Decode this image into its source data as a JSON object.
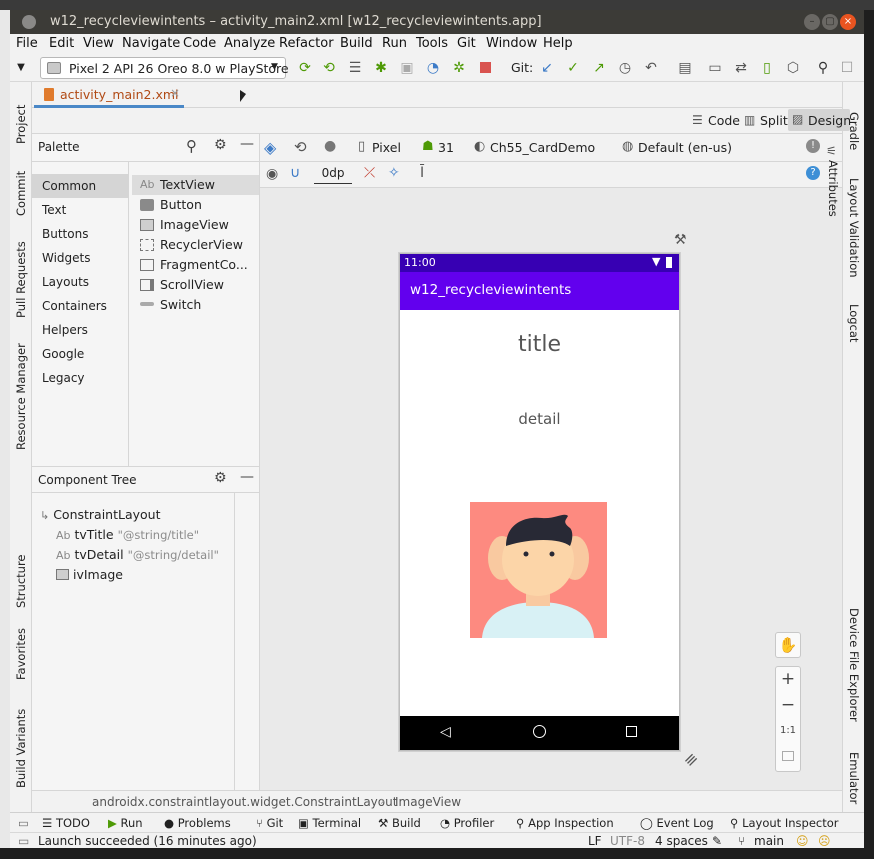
{
  "window": {
    "title": "w12_recycleviewintents – activity_main2.xml [w12_recycleviewintents.app]"
  },
  "menu": [
    "File",
    "Edit",
    "View",
    "Navigate",
    "Code",
    "Analyze",
    "Refactor",
    "Build",
    "Run",
    "Tools",
    "Git",
    "Window",
    "Help"
  ],
  "toolbar": {
    "device": "Pixel 2 API 26 Oreo 8.0 w PlayStore",
    "git_label": "Git:"
  },
  "left_tool_tabs": [
    "Project",
    "Commit",
    "Pull Requests",
    "Resource Manager",
    "Structure",
    "Favorites",
    "Build Variants"
  ],
  "right_tool_tabs": [
    "Gradle",
    "Layout Validation",
    "Logcat",
    "Device File Explorer",
    "Emulator"
  ],
  "editor": {
    "file_tab": "activity_main2.xml",
    "view_modes": [
      "Code",
      "Split",
      "Design"
    ]
  },
  "palette": {
    "title": "Palette",
    "categories": [
      "Common",
      "Text",
      "Buttons",
      "Widgets",
      "Layouts",
      "Containers",
      "Helpers",
      "Google",
      "Legacy"
    ],
    "items": [
      "TextView",
      "Button",
      "ImageView",
      "RecyclerView",
      "FragmentCo...",
      "ScrollView",
      "Switch"
    ],
    "textview_prefix": "Ab"
  },
  "component_tree": {
    "title": "Component Tree",
    "root": "ConstraintLayout",
    "children": [
      {
        "prefix": "Ab",
        "name": "tvTitle",
        "attr": "\"@string/title\""
      },
      {
        "prefix": "Ab",
        "name": "tvDetail",
        "attr": "\"@string/detail\""
      },
      {
        "prefix": "",
        "name": "ivImage",
        "attr": ""
      }
    ]
  },
  "surface_toolbar": {
    "device": "Pixel",
    "api": "31",
    "theme": "Ch55_CardDemo",
    "locale": "Default (en-us)",
    "margin": "0dp",
    "attributes_tab": "Attributes"
  },
  "phone": {
    "time": "11:00",
    "app_title": "w12_recycleviewintents",
    "title_text": "title",
    "detail_text": "detail"
  },
  "zoom": {
    "plus": "+",
    "minus": "−",
    "ratio": "1:1"
  },
  "breadcrumbs": [
    "androidx.constraintlayout.widget.ConstraintLayout",
    "ImageView"
  ],
  "bottom_tabs": [
    "TODO",
    "Run",
    "Problems",
    "Git",
    "Terminal",
    "Build",
    "Profiler",
    "App Inspection",
    "Event Log",
    "Layout Inspector"
  ],
  "status": {
    "message": "Launch succeeded (16 minutes ago)",
    "line_sep": "LF",
    "encoding": "UTF-8",
    "indent": "4 spaces",
    "branch": "main"
  },
  "colors": {
    "status_bar": "#3700b3",
    "app_bar": "#6200ee",
    "avatar_bg": "#fd8a80"
  }
}
